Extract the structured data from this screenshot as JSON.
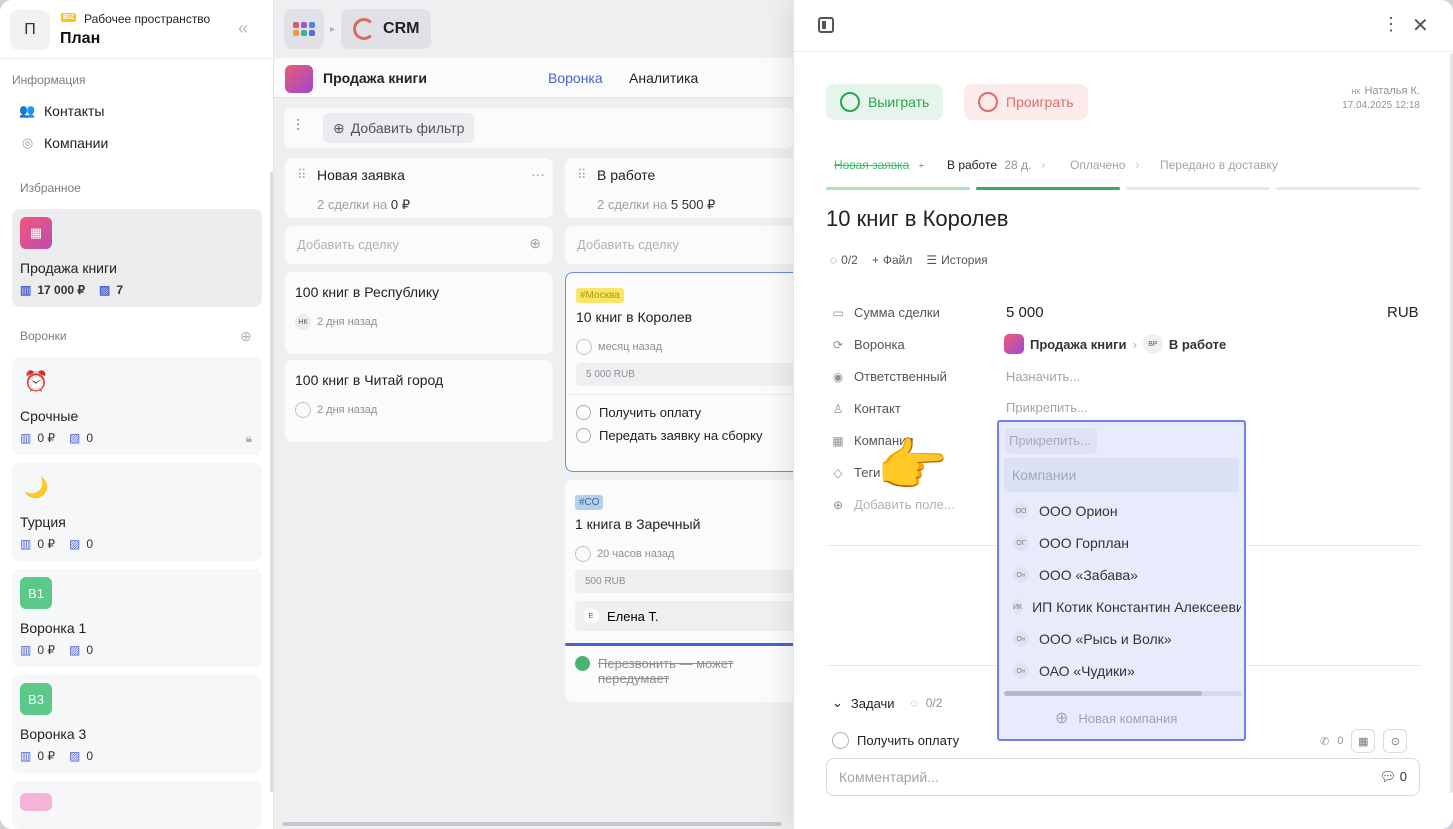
{
  "workspace": {
    "avatar": "П",
    "badge": "BIZ",
    "subtitle": "Рабочее пространство",
    "name": "План"
  },
  "sidebar": {
    "info_label": "Информация",
    "items": [
      {
        "label": "Контакты",
        "icon": "contacts-icon"
      },
      {
        "label": "Компании",
        "icon": "globe-icon"
      }
    ],
    "favorites_label": "Избранное",
    "favorite": {
      "name": "Продажа книги",
      "amount": "17 000 ₽",
      "count": "7"
    },
    "funnels_label": "Воронки",
    "funnels": [
      {
        "name": "Срочные",
        "amount": "0 ₽",
        "count": "0",
        "icon": "⏰"
      },
      {
        "name": "Турция",
        "amount": "0 ₽",
        "count": "0",
        "icon": "🌙"
      },
      {
        "name": "Воронка 1",
        "amount": "0 ₽",
        "count": "0",
        "icon": "В1"
      },
      {
        "name": "Воронка 3",
        "amount": "0 ₽",
        "count": "0",
        "icon": "В3"
      }
    ]
  },
  "topbar": {
    "app": "CRM"
  },
  "pipeline": {
    "title": "Продажа книги",
    "tabs": [
      "Воронка",
      "Аналитика"
    ],
    "add_filter": "Добавить фильтр"
  },
  "columns": [
    {
      "title": "Новая заявка",
      "stats_pre": "2 сделки на",
      "stats_val": "0 ₽",
      "add": "Добавить сделку",
      "deals": [
        {
          "title": "100 книг в Республику",
          "avatar": "НК",
          "time": "2 дня назад"
        },
        {
          "title": "100 книг в Читай город",
          "avatar": "",
          "time": "2 дня назад"
        }
      ]
    },
    {
      "title": "В работе",
      "stats_pre": "2 сделки на",
      "stats_val": "5 500 ₽",
      "add": "Добавить сделку",
      "deals": [
        {
          "tag": "#Москва",
          "title": "10 книг в Королев",
          "time": "месяц назад",
          "amount": "5 000 RUB",
          "tasks": [
            "Получить оплату",
            "Передать заявку на сборку"
          ]
        },
        {
          "tag": "#СО",
          "title": "1 книга в Заречный",
          "time": "20 часов назад",
          "amount": "500 RUB",
          "contact_av": "Е",
          "contact": "Елена Т.",
          "done_task": "Перезвонить — может передумает"
        }
      ]
    }
  ],
  "panel": {
    "win": "Выиграть",
    "lose": "Проиграть",
    "author_av": "НК",
    "author": "Наталья К.",
    "date": "17.04.2025 12:18",
    "stages": [
      {
        "label": "Новая заявка",
        "status": "done"
      },
      {
        "label": "В работе",
        "extra": "28 д.",
        "status": "current"
      },
      {
        "label": "Оплачено",
        "status": "todo"
      },
      {
        "label": "Передано в доставку",
        "status": "todo"
      }
    ],
    "title": "10 книг в Королев",
    "actions": {
      "progress": "0/2",
      "file": "Файл",
      "history": "История"
    },
    "fields": {
      "amount_label": "Сумма сделки",
      "amount": "5 000",
      "currency": "RUB",
      "funnel_label": "Воронка",
      "funnel": "Продажа книги",
      "stage_av": "ВР",
      "stage": "В работе",
      "owner_label": "Ответственный",
      "owner": "Назначить...",
      "contact_label": "Контакт",
      "contact": "Прикрепить...",
      "company_label": "Компания",
      "tags_label": "Теги",
      "add_field": "Добавить поле..."
    },
    "tasks_label": "Задачи",
    "tasks_progress": "0/2",
    "task": "Получить оплату",
    "task_calls": "0",
    "comment_placeholder": "Комментарий...",
    "comment_count": "0"
  },
  "dropdown": {
    "input": "Прикрепить...",
    "search_placeholder": "Компании",
    "options": [
      {
        "av": "ОО",
        "label": "ООО Орион"
      },
      {
        "av": "ОГ",
        "label": "ООО Горплан"
      },
      {
        "av": "О«",
        "label": "ООО «Забава»"
      },
      {
        "av": "ИК",
        "label": "ИП Котик Константин Алексеевич"
      },
      {
        "av": "О«",
        "label": "ООО «Рысь и Волк»"
      },
      {
        "av": "О«",
        "label": "ОАО «Чудики»"
      }
    ],
    "new": "Новая компания"
  },
  "colors": {
    "accent": "#4a62d6",
    "win": "#2aa54f",
    "lose": "#e06b6b",
    "highlight": "#6f7ff0"
  }
}
